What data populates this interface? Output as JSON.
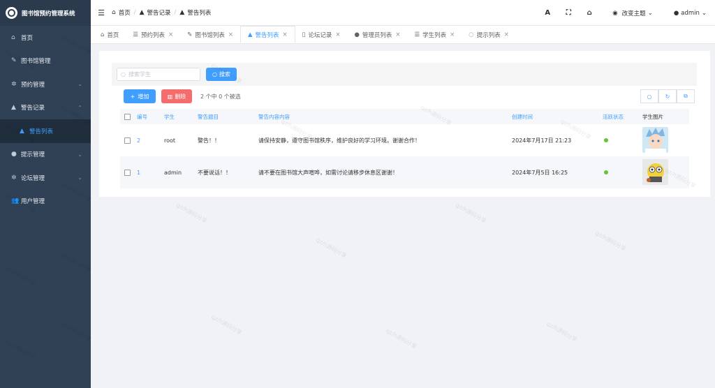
{
  "app": {
    "title": "图书馆预约管理系统"
  },
  "sidebar": {
    "items": [
      {
        "label": "首页",
        "icon": "home-icon"
      },
      {
        "label": "图书馆管理",
        "icon": "edit-icon"
      },
      {
        "label": "预约管理",
        "icon": "gear-icon"
      },
      {
        "label": "警告记录",
        "icon": "warning-icon"
      },
      {
        "label": "警告列表",
        "icon": "warning-icon"
      },
      {
        "label": "提示管理",
        "icon": "chat-icon"
      },
      {
        "label": "论坛管理",
        "icon": "gear-icon"
      },
      {
        "label": "用户管理",
        "icon": "users-icon"
      }
    ]
  },
  "breadcrumb": [
    "首页",
    "警告记录",
    "警告列表"
  ],
  "header": {
    "theme_label": "改变主题",
    "user_label": "admin",
    "font_icon_char": "A"
  },
  "tabs": [
    {
      "label": "首页",
      "active": false,
      "closable": false
    },
    {
      "label": "预约列表",
      "active": false,
      "closable": true
    },
    {
      "label": "图书馆列表",
      "active": false,
      "closable": true
    },
    {
      "label": "警告列表",
      "active": true,
      "closable": true
    },
    {
      "label": "论坛记录",
      "active": false,
      "closable": true
    },
    {
      "label": "管理员列表",
      "active": false,
      "closable": true
    },
    {
      "label": "学生列表",
      "active": false,
      "closable": true
    },
    {
      "label": "提示列表",
      "active": false,
      "closable": true
    }
  ],
  "search": {
    "placeholder": "搜索学生",
    "button_label": "搜索"
  },
  "actions": {
    "add_label": "增加",
    "delete_label": "删除",
    "selection_text": "2 个中 0 个被选"
  },
  "table": {
    "headers": [
      "编号",
      "学生",
      "警告题目",
      "警告内容内容",
      "创建时间",
      "活跃状态",
      "学生图片"
    ],
    "rows": [
      {
        "id": "2",
        "student": "root",
        "title": "警告！！",
        "content": "请保持安静，遵守图书馆秩序，维护良好的学习环境。谢谢合作！",
        "created": "2024年7月17日 21:23",
        "active": true
      },
      {
        "id": "1",
        "student": "admin",
        "title": "不要说话！！",
        "content": "请不要在图书馆大声喧哗，如需讨论请移步休息区谢谢！",
        "created": "2024年7月5日 16:25",
        "active": true
      }
    ]
  },
  "watermark": "qz/h源码分享",
  "colors": {
    "primary": "#409eff",
    "danger": "#f56c6c",
    "success": "#67c23a",
    "sidebar": "#304156"
  }
}
